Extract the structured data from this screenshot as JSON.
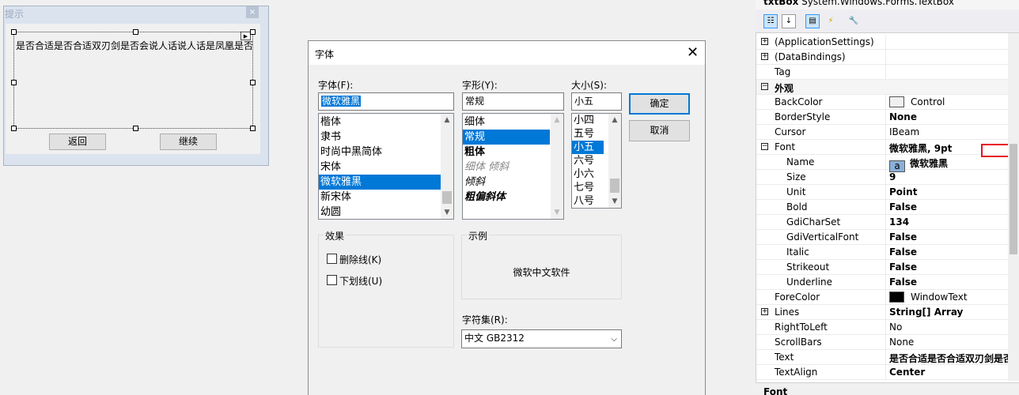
{
  "form": {
    "title": "提示",
    "close_glyph": "×",
    "textbox_text": "是否合适是否合适双刃剑是否会说人话说人话是凤凰是否",
    "back_button": "返回",
    "continue_button": "继续"
  },
  "font_dialog": {
    "title": "字体",
    "font_label": "字体(F):",
    "font_value": "微软雅黑",
    "fonts": [
      "楷体",
      "隶书",
      "时尚中黑简体",
      "宋体",
      "微软雅黑",
      "新宋体",
      "幼圆"
    ],
    "style_label": "字形(Y):",
    "style_value": "常规",
    "styles": [
      "细体",
      "常规",
      "粗体",
      "细体 倾斜",
      "倾斜",
      "粗偏斜体"
    ],
    "size_label": "大小(S):",
    "size_value": "小五",
    "sizes": [
      "小四",
      "五号",
      "小五",
      "六号",
      "小六",
      "七号",
      "八号"
    ],
    "ok_button": "确定",
    "cancel_button": "取消",
    "effects_label": "效果",
    "strikeout_label": "删除线(K)",
    "underline_label": "下划线(U)",
    "sample_label": "示例",
    "sample_text": "微软中文软件",
    "charset_label": "字符集(R):",
    "charset_value": "中文 GB2312"
  },
  "property_grid": {
    "header_name": "txtBox",
    "header_type": "System.Windows.Forms.TextBox",
    "rows": [
      {
        "name": "(ApplicationSettings)",
        "value": "",
        "expander": "+"
      },
      {
        "name": "(DataBindings)",
        "value": "",
        "expander": "+"
      },
      {
        "name": "Tag",
        "value": ""
      },
      {
        "name": "外观",
        "value": "",
        "expander": "−",
        "category": true
      },
      {
        "name": "BackColor",
        "value": "Control",
        "swatch": "#f0f0f0"
      },
      {
        "name": "BorderStyle",
        "value": "None",
        "bold": true
      },
      {
        "name": "Cursor",
        "value": "IBeam"
      },
      {
        "name": "Font",
        "value": "微软雅黑, 9pt",
        "expander": "−",
        "bold": true
      },
      {
        "name": "Name",
        "value": "微软雅黑",
        "indent": true,
        "bold": true,
        "fontglyph": "a"
      },
      {
        "name": "Size",
        "value": "9",
        "indent": true,
        "bold": true
      },
      {
        "name": "Unit",
        "value": "Point",
        "indent": true,
        "bold": true
      },
      {
        "name": "Bold",
        "value": "False",
        "indent": true,
        "bold": true
      },
      {
        "name": "GdiCharSet",
        "value": "134",
        "indent": true,
        "bold": true
      },
      {
        "name": "GdiVerticalFont",
        "value": "False",
        "indent": true,
        "bold": true
      },
      {
        "name": "Italic",
        "value": "False",
        "indent": true,
        "bold": true
      },
      {
        "name": "Strikeout",
        "value": "False",
        "indent": true,
        "bold": true
      },
      {
        "name": "Underline",
        "value": "False",
        "indent": true,
        "bold": true
      },
      {
        "name": "ForeColor",
        "value": "WindowText",
        "swatch": "#000000"
      },
      {
        "name": "Lines",
        "value": "String[] Array",
        "expander": "+",
        "bold": true
      },
      {
        "name": "RightToLeft",
        "value": "No"
      },
      {
        "name": "ScrollBars",
        "value": "None"
      },
      {
        "name": "Text",
        "value": "是否合适是否合适双刃剑是否",
        "bold": true
      },
      {
        "name": "TextAlign",
        "value": "Center",
        "bold": true
      }
    ],
    "description_title": "Font",
    "highlight_color": "#e81123",
    "accent_color": "#0078d7"
  }
}
